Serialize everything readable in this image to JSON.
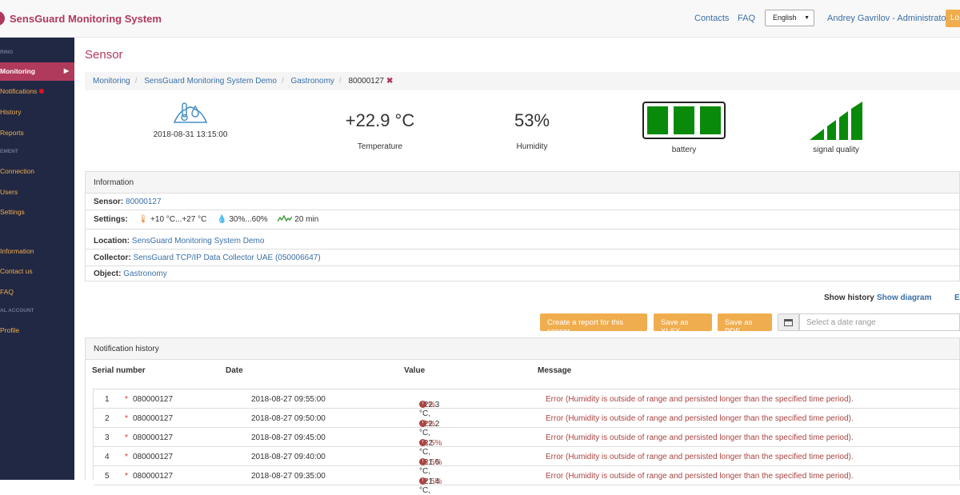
{
  "header": {
    "brand": "SensGuard Monitoring System",
    "links": {
      "contacts": "Contacts",
      "faq": "FAQ"
    },
    "language": "English",
    "user": "Andrey Gavrilov - Administrator",
    "logout": "Lo"
  },
  "sidebar": {
    "sections": {
      "monitoring": "RING",
      "management": "EMENT",
      "personal": "AL ACCOUNT"
    },
    "items": [
      {
        "label": "Monitoring"
      },
      {
        "label": "Notifications"
      },
      {
        "label": "History"
      },
      {
        "label": "Reports"
      },
      {
        "label": "Connection"
      },
      {
        "label": "Users"
      },
      {
        "label": "Settings"
      },
      {
        "label": "Information"
      },
      {
        "label": "Contact us"
      },
      {
        "label": "FAQ"
      },
      {
        "label": "Profile"
      }
    ]
  },
  "page": {
    "title": "Sensor",
    "breadcrumb": [
      "Monitoring",
      "SensGuard Monitoring System Demo",
      "Gastronomy"
    ],
    "breadcrumb_current": "80000127"
  },
  "stats": {
    "timestamp": "2018-08-31 13:15:00",
    "temperature": "+22.9 °C",
    "temperature_label": "Temperature",
    "humidity": "53%",
    "humidity_label": "Humidity",
    "battery_label": "battery",
    "battery_cells": 3,
    "signal_label": "signal quality",
    "signal_bars": 4
  },
  "information": {
    "heading": "Information",
    "sensor_label": "Sensor:",
    "sensor_value": "80000127",
    "settings_label": "Settings:",
    "settings_temp": "+10 °C...+27 °C",
    "settings_hum": "30%...60%",
    "settings_interval": "20 min",
    "location_label": "Location:",
    "location_value": "SensGuard Monitoring System Demo",
    "collector_label": "Collector:",
    "collector_value": "SensGuard TCP/IP Data Collector UAE (050006647)",
    "object_label": "Object:",
    "object_value": "Gastronomy"
  },
  "view_toggle": {
    "history": "Show history",
    "diagram": "Show diagram",
    "extra": "E"
  },
  "actions": {
    "report": "Create a report for this sensor",
    "xlsx": "Save as XLSX",
    "pdf": "Save as PDF",
    "date_placeholder": "Select a date range"
  },
  "notifications": {
    "heading": "Notification history",
    "columns": {
      "serial": "Serial number",
      "date": "Date",
      "value": "Value",
      "message": "Message"
    },
    "rows": [
      {
        "n": "1",
        "serial": "080000127",
        "date": "2018-08-27 09:55:00",
        "temp": "+22.3 °C,",
        "hum": "61%",
        "message": "Error (Humidity is outside of range and persisted longer than the specified time period)."
      },
      {
        "n": "2",
        "serial": "080000127",
        "date": "2018-08-27 09:50:00",
        "temp": "+22.2 °C,",
        "hum": "62%",
        "message": "Error (Humidity is outside of range and persisted longer than the specified time period)."
      },
      {
        "n": "3",
        "serial": "080000127",
        "date": "2018-08-27 09:45:00",
        "temp": "+22 °C,",
        "hum": "63.5%",
        "message": "Error (Humidity is outside of range and persisted longer than the specified time period)."
      },
      {
        "n": "4",
        "serial": "080000127",
        "date": "2018-08-27 09:40:00",
        "temp": "+21.6 °C,",
        "hum": "65.5%",
        "message": "Error (Humidity is outside of range and persisted longer than the specified time period)."
      },
      {
        "n": "5",
        "serial": "080000127",
        "date": "2018-08-27 09:35:00",
        "temp": "+21.4 °C,",
        "hum": "67.5%",
        "message": "Error (Humidity is outside of range and persisted longer than the specified time period)."
      }
    ]
  },
  "colors": {
    "brand": "#b03a5b",
    "sidebar": "#212843",
    "accent": "#f0ad4e",
    "link": "#3a6fa6",
    "ok": "#0a8a0a",
    "error": "#a94442"
  }
}
